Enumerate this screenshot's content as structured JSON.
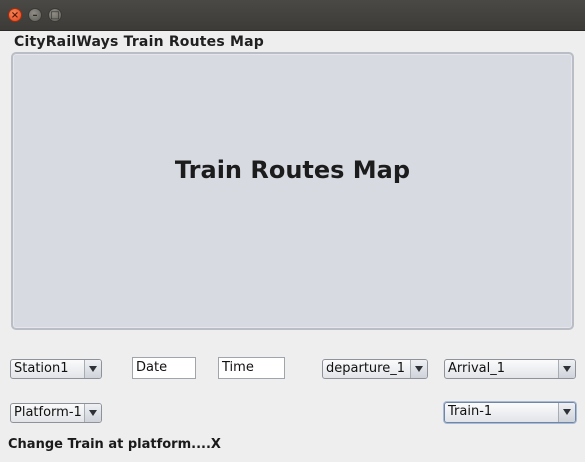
{
  "window": {
    "buttons": {
      "close": "×",
      "minimize": "–",
      "maximize": "□"
    }
  },
  "app": {
    "title": "CityRailWays Train Routes Map"
  },
  "map": {
    "label": "Train Routes Map"
  },
  "controls": {
    "station": {
      "selected": "Station1"
    },
    "date": {
      "value": "Date"
    },
    "time": {
      "value": "Time"
    },
    "departure": {
      "selected": "departure_1"
    },
    "arrival": {
      "selected": "Arrival_1"
    },
    "platform": {
      "selected": "Platform-1"
    },
    "train": {
      "selected": "Train-1"
    }
  },
  "status": {
    "text": "Change Train at platform....X"
  }
}
